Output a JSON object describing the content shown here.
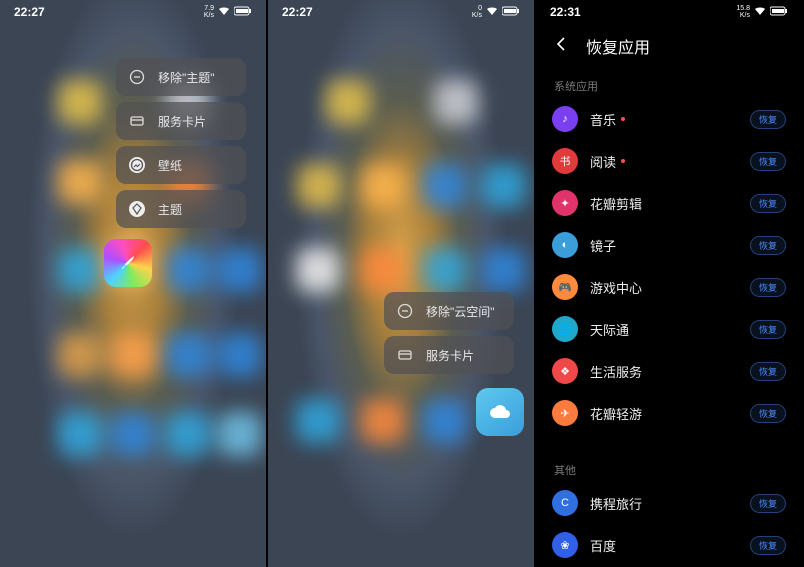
{
  "screens": {
    "s1": {
      "time": "22:27",
      "net_speed": "7.9\nK/s",
      "ctx": [
        {
          "icon": "remove",
          "label": "移除\"主题\""
        },
        {
          "icon": "card",
          "label": "服务卡片"
        },
        {
          "icon": "wp",
          "label": "壁纸"
        },
        {
          "icon": "theme",
          "label": "主题"
        }
      ]
    },
    "s2": {
      "time": "22:27",
      "net_speed": "0\nK/s",
      "ctx": [
        {
          "icon": "remove",
          "label": "移除\"云空间\""
        },
        {
          "icon": "card",
          "label": "服务卡片"
        }
      ]
    },
    "s3": {
      "time": "22:31",
      "net_speed": "15.8\nK/s",
      "title": "恢复应用",
      "section_sys": "系统应用",
      "section_other": "其他",
      "restore_label": "恢复",
      "apps_sys": [
        {
          "name": "音乐",
          "dot": true,
          "bg": "#7b3ff2",
          "glyph": "♪"
        },
        {
          "name": "阅读",
          "dot": true,
          "bg": "#e03a3a",
          "glyph": "书"
        },
        {
          "name": "花瓣剪辑",
          "dot": false,
          "bg": "#e0336b",
          "glyph": "✦"
        },
        {
          "name": "镜子",
          "dot": false,
          "bg": "#3a9edb",
          "glyph": "◐"
        },
        {
          "name": "游戏中心",
          "dot": false,
          "bg": "#ff8a3d",
          "glyph": "🎮"
        },
        {
          "name": "天际通",
          "dot": false,
          "bg": "#1fa8c9",
          "glyph": "🌐"
        },
        {
          "name": "生活服务",
          "dot": false,
          "bg": "#f04848",
          "glyph": "❖"
        },
        {
          "name": "花瓣轻游",
          "dot": false,
          "bg": "#ff7a3d",
          "glyph": "✈"
        }
      ],
      "apps_other": [
        {
          "name": "携程旅行",
          "bg": "#2f6fe0",
          "glyph": "C"
        },
        {
          "name": "百度",
          "bg": "#3060e8",
          "glyph": "❀"
        }
      ]
    }
  }
}
